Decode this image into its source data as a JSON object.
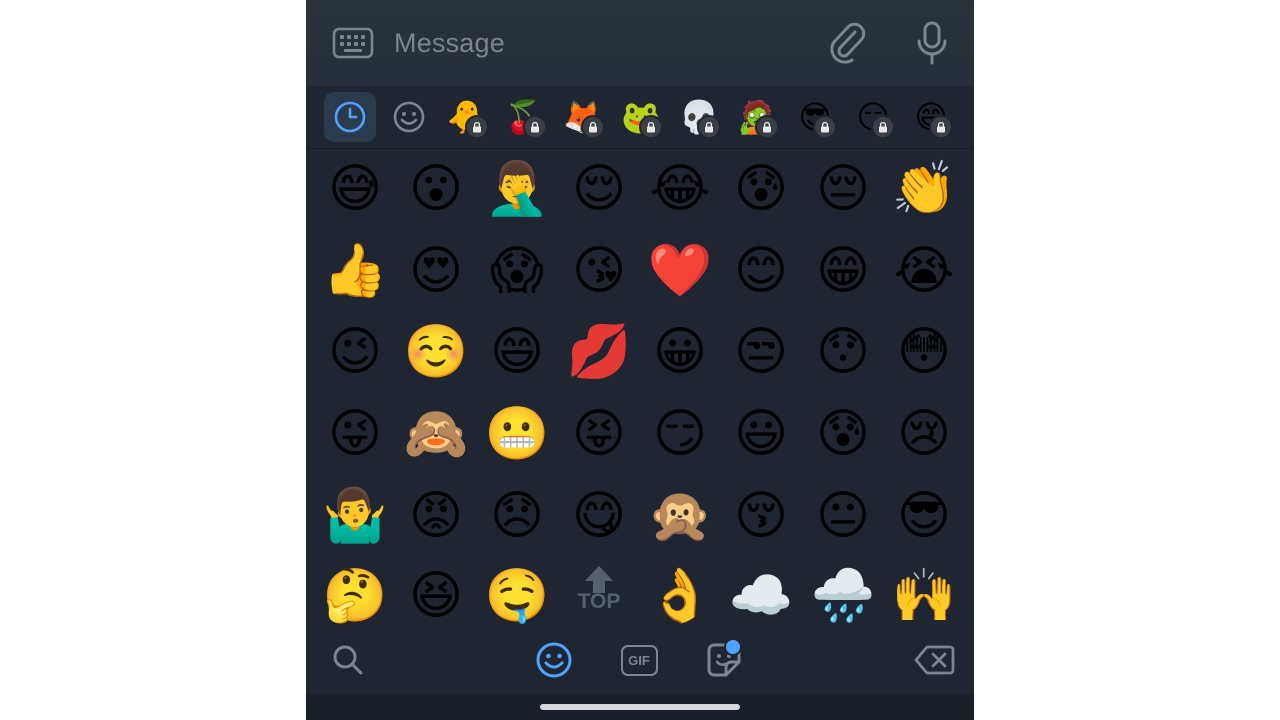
{
  "message_bar": {
    "placeholder": "Message",
    "keyboard_icon": "keyboard-icon",
    "attach_icon": "paperclip-icon",
    "mic_icon": "microphone-icon"
  },
  "categories": [
    {
      "name": "recent",
      "glyph": "",
      "active": true,
      "locked": false
    },
    {
      "name": "emoji",
      "glyph": "",
      "active": false,
      "locked": false
    },
    {
      "name": "duck-pack",
      "glyph": "🐥",
      "active": false,
      "locked": true
    },
    {
      "name": "pink-creature-pack",
      "glyph": "🍒",
      "active": false,
      "locked": true
    },
    {
      "name": "orange-creature-pack",
      "glyph": "🦊",
      "active": false,
      "locked": true
    },
    {
      "name": "frog-pack",
      "glyph": "🐸",
      "active": false,
      "locked": true
    },
    {
      "name": "skull-pack",
      "glyph": "💀",
      "active": false,
      "locked": true
    },
    {
      "name": "zombie-pack",
      "glyph": "🧟",
      "active": false,
      "locked": true
    },
    {
      "name": "cool-face-pack",
      "glyph": "😎",
      "active": false,
      "locked": true
    },
    {
      "name": "troll-face-pack",
      "glyph": "😏",
      "active": false,
      "locked": true
    },
    {
      "name": "grin-pack",
      "glyph": "😄",
      "active": false,
      "locked": true
    }
  ],
  "emoji_rows": [
    [
      "😅",
      "😮",
      "🤦‍♂️",
      "😌",
      "😂",
      "😰",
      "😔",
      "👏"
    ],
    [
      "👍",
      "😍",
      "😱",
      "😘",
      "❤️",
      "😊",
      "😁",
      "😭"
    ],
    [
      "😉",
      "☺️",
      "😄",
      "💋",
      "😀",
      "😒",
      "😯",
      "😳"
    ],
    [
      "😜",
      "🙈",
      "😬",
      "😝",
      "😏",
      "😃",
      "😰",
      "😢"
    ],
    [
      "🤷‍♂️",
      "😡",
      "😞",
      "😋",
      "🙊",
      "😚",
      "😐",
      "😎"
    ],
    [
      "🤔",
      "😆",
      "🤤",
      "TOP",
      "👌",
      "☁️",
      "🌧️",
      "🙌"
    ]
  ],
  "top_button": {
    "label": "TOP"
  },
  "bottom_bar": {
    "search_icon": "search-icon",
    "emoji_tab_icon": "smiley-icon",
    "gif_label": "GIF",
    "sticker_icon": "sticker-icon"
  },
  "colors": {
    "panel_bg": "#1f2632",
    "accent": "#4da3ff",
    "icon_gray": "#7c8590"
  }
}
